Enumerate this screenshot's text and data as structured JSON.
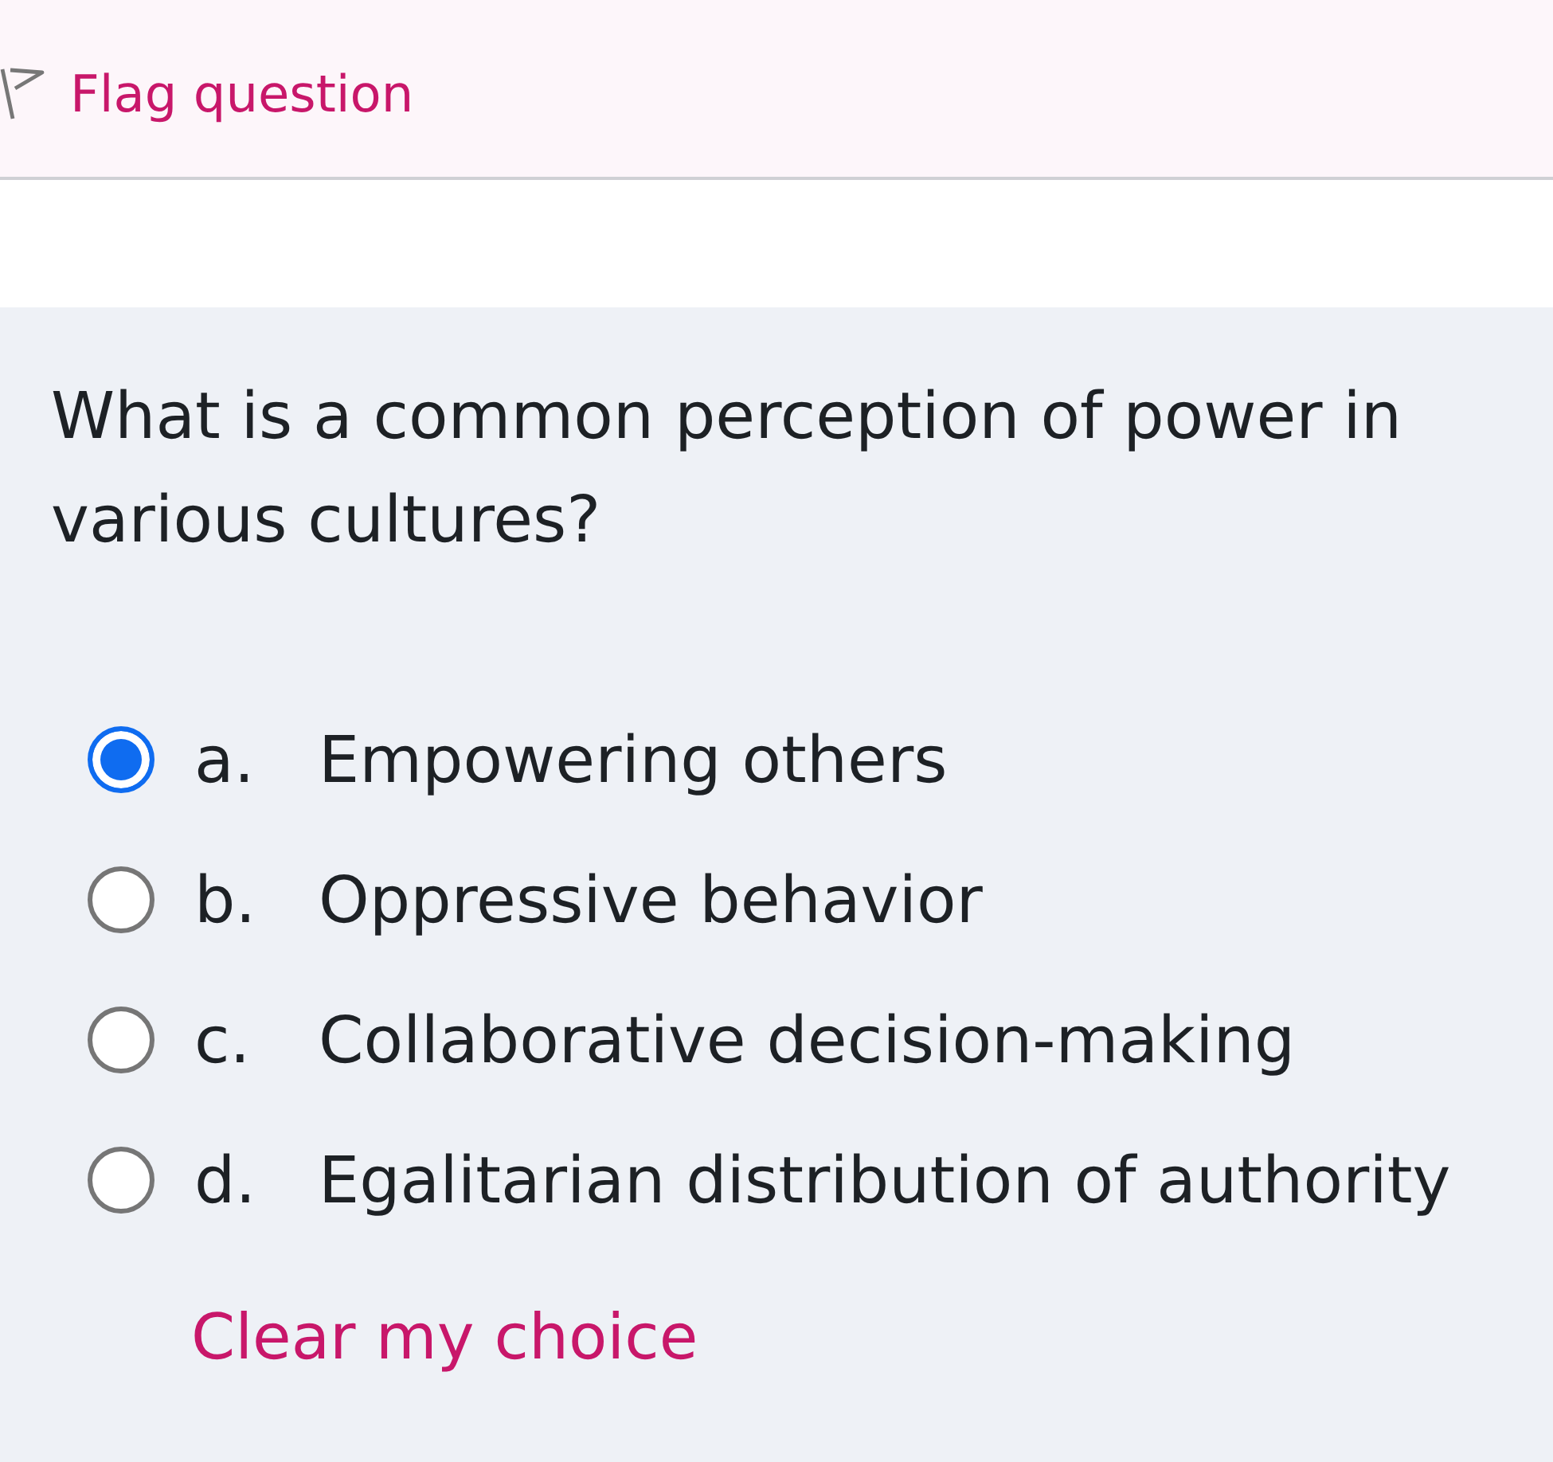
{
  "flag_question": {
    "label": "Flag question"
  },
  "question": {
    "text": "What is a common perception of power in various cultures?"
  },
  "options": [
    {
      "letter": "a.",
      "text": "Empowering others",
      "selected": true
    },
    {
      "letter": "b.",
      "text": "Oppressive behavior",
      "selected": false
    },
    {
      "letter": "c.",
      "text": "Collaborative decision-making",
      "selected": false
    },
    {
      "letter": "d.",
      "text": "Egalitarian distribution of authority",
      "selected": false
    }
  ],
  "clear_choice": {
    "label": "Clear my choice"
  }
}
